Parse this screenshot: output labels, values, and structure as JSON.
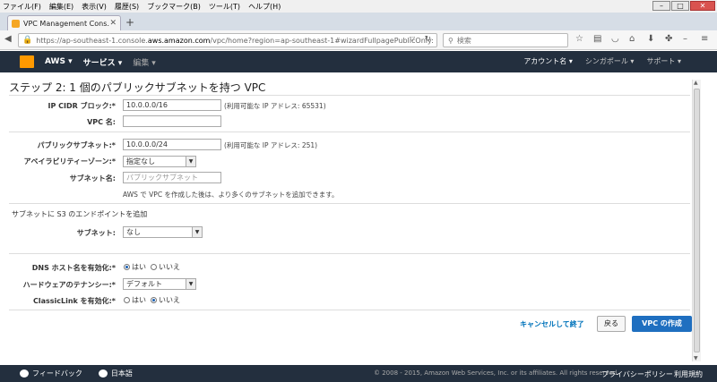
{
  "browser": {
    "menu": [
      "ファイル(F)",
      "編集(E)",
      "表示(V)",
      "履歴(S)",
      "ブックマーク(B)",
      "ツール(T)",
      "ヘルプ(H)"
    ],
    "tab_title": "VPC Management Cons…",
    "url_prefix": "https://ap-southeast-1.console.",
    "url_domain": "aws.amazon.com",
    "url_suffix": "/vpc/home?region=ap-southeast-1#wizardFullpagePublicOnly:",
    "search_placeholder": "検索"
  },
  "aws_nav": {
    "brand": "AWS",
    "services": "サービス",
    "edit": "編集",
    "account": "アカウント名",
    "region": "シンガポール",
    "support": "サポート"
  },
  "page": {
    "title": "ステップ 2: 1 個のパブリックサブネットを持つ VPC"
  },
  "form": {
    "cidr_label": "IP CIDR ブロック:*",
    "cidr_value": "10.0.0.0/16",
    "cidr_hint": "(利用可能な IP アドレス: 65531)",
    "vpc_name_label": "VPC 名:",
    "vpc_name_value": "",
    "subnet_cidr_label": "パブリックサブネット:*",
    "subnet_cidr_value": "10.0.0.0/24",
    "subnet_cidr_hint": "(利用可能な IP アドレス: 251)",
    "az_label": "アベイラビリティーゾーン:*",
    "az_value": "指定なし",
    "subnet_name_label": "サブネット名:",
    "subnet_name_placeholder": "パブリックサブネット",
    "subnet_note": "AWS で VPC を作成した後は、より多くのサブネットを追加できます。",
    "s3_endpoint_text": "サブネットに S3 のエンドポイントを追加",
    "s3_subnet_label": "サブネット:",
    "s3_subnet_value": "なし",
    "dns_label": "DNS ホスト名を有効化:*",
    "dns_yes": "はい",
    "dns_no": "いいえ",
    "tenancy_label": "ハードウェアのテナンシー:*",
    "tenancy_value": "デフォルト",
    "classiclink_label": "ClassicLink を有効化:*",
    "cl_yes": "はい",
    "cl_no": "いいえ"
  },
  "actions": {
    "cancel": "キャンセルして終了",
    "back": "戻る",
    "create": "VPC の作成"
  },
  "footer": {
    "feedback": "フィードバック",
    "language": "日本語",
    "copyright": "© 2008 - 2015, Amazon Web Services, Inc. or its affiliates. All rights reserved.",
    "privacy": "プライバシーポリシー",
    "terms": "利用規約"
  }
}
